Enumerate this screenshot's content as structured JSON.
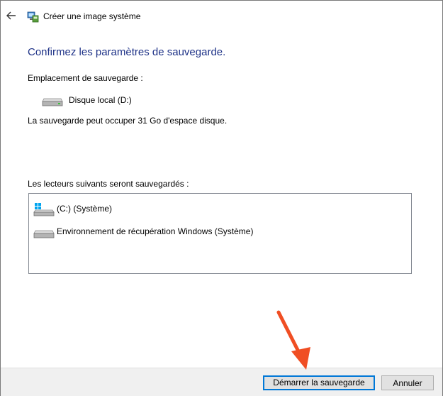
{
  "window": {
    "title": "Créer une image système",
    "back_icon": "back-arrow-icon",
    "app_icon": "backup-restore-icon"
  },
  "main": {
    "heading": "Confirmez les paramètres de sauvegarde.",
    "location_label": "Emplacement de sauvegarde :",
    "location_drive": "Disque local (D:)",
    "space_note": "La sauvegarde peut occuper 31 Go d'espace disque.",
    "drives_label": "Les lecteurs suivants seront sauvegardés :",
    "drives": [
      {
        "label": "(C:) (Système)",
        "icon": "windows-drive-icon"
      },
      {
        "label": "Environnement de récupération Windows (Système)",
        "icon": "hard-drive-icon"
      }
    ]
  },
  "buttons": {
    "start": "Démarrer la sauvegarde",
    "cancel": "Annuler"
  },
  "colors": {
    "heading": "#1e3287",
    "button_focus": "#0078d7",
    "arrow": "#f04e23"
  }
}
